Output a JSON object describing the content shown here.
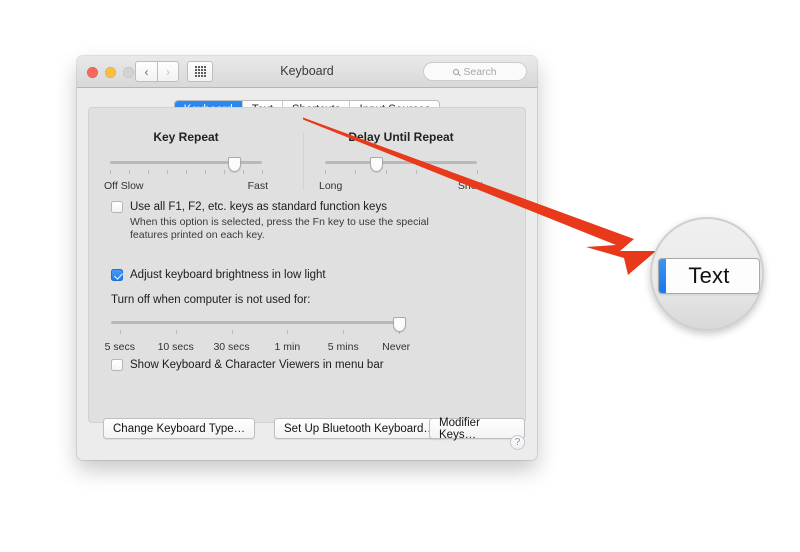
{
  "window": {
    "title": "Keyboard",
    "traffic_lights": [
      "close-red",
      "minimize-yellow",
      "zoom-disabled"
    ],
    "nav": {
      "back": "‹",
      "forward": "›",
      "grid": "grid-icon"
    },
    "search": {
      "placeholder": "Search",
      "value": "",
      "icon": "search-icon"
    },
    "help": {
      "label": "?"
    }
  },
  "tabs": [
    {
      "label": "Keyboard",
      "selected": true
    },
    {
      "label": "Text",
      "selected": false
    },
    {
      "label": "Shortcuts",
      "selected": false
    },
    {
      "label": "Input Sources",
      "selected": false
    }
  ],
  "sliders": {
    "key_repeat": {
      "title": "Key Repeat",
      "left_label": "Off Slow",
      "right_label": "Fast",
      "ticks": 9,
      "value_percent": 82
    },
    "delay_until_repeat": {
      "title": "Delay Until Repeat",
      "left_label": "Long",
      "right_label": "Short",
      "ticks": 6,
      "value_percent": 34
    }
  },
  "options": {
    "fn_keys": {
      "label": "Use all F1, F2, etc. keys as standard function keys",
      "checked": false,
      "description_line1": "When this option is selected, press the Fn key to use the special",
      "description_line2": "features printed on each key."
    },
    "adjust_brightness": {
      "label": "Adjust keyboard brightness in low light",
      "checked": true
    },
    "show_viewers": {
      "label": "Show Keyboard & Character Viewers in menu bar",
      "checked": false
    }
  },
  "timeout": {
    "title": "Turn off when computer is not used for:",
    "labels": [
      "5 secs",
      "10 secs",
      "30 secs",
      "1 min",
      "5 mins",
      "Never"
    ],
    "selected": "Never",
    "value_percent": 100
  },
  "buttons": {
    "change_keyboard_type": "Change Keyboard Type…",
    "set_up_bluetooth": "Set Up Bluetooth Keyboard…",
    "modifier_keys": "Modifier Keys…"
  },
  "callout": {
    "arrow_color": "#e8391a",
    "target_tab": "Text",
    "magnifier_label": "Text"
  }
}
